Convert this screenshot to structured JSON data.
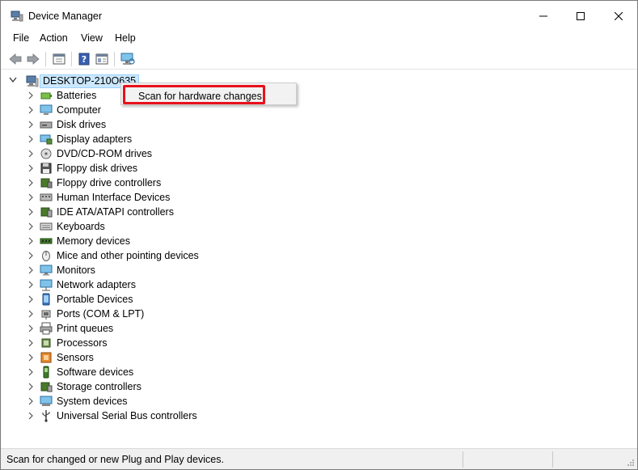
{
  "window": {
    "title": "Device Manager"
  },
  "menubar": {
    "items": [
      "File",
      "Action",
      "View",
      "Help"
    ]
  },
  "toolbar": {
    "buttons": [
      "back-arrow-icon",
      "forward-arrow-icon",
      "properties-pane-icon",
      "help-icon",
      "show-hide-tree-icon",
      "scan-hardware-icon"
    ]
  },
  "tree": {
    "root": "DESKTOP-210O635",
    "nodes": [
      {
        "label": "Batteries",
        "icon": "battery-icon"
      },
      {
        "label": "Computer",
        "icon": "computer-icon"
      },
      {
        "label": "Disk drives",
        "icon": "disk-drive-icon"
      },
      {
        "label": "Display adapters",
        "icon": "display-adapter-icon"
      },
      {
        "label": "DVD/CD-ROM drives",
        "icon": "dvd-drive-icon"
      },
      {
        "label": "Floppy disk drives",
        "icon": "floppy-drive-icon"
      },
      {
        "label": "Floppy drive controllers",
        "icon": "floppy-controller-icon"
      },
      {
        "label": "Human Interface Devices",
        "icon": "hid-icon"
      },
      {
        "label": "IDE ATA/ATAPI controllers",
        "icon": "ide-controller-icon"
      },
      {
        "label": "Keyboards",
        "icon": "keyboard-icon"
      },
      {
        "label": "Memory devices",
        "icon": "memory-icon"
      },
      {
        "label": "Mice and other pointing devices",
        "icon": "mouse-icon"
      },
      {
        "label": "Monitors",
        "icon": "monitor-icon"
      },
      {
        "label": "Network adapters",
        "icon": "network-adapter-icon"
      },
      {
        "label": "Portable Devices",
        "icon": "portable-device-icon"
      },
      {
        "label": "Ports (COM & LPT)",
        "icon": "port-icon"
      },
      {
        "label": "Print queues",
        "icon": "printer-icon"
      },
      {
        "label": "Processors",
        "icon": "processor-icon"
      },
      {
        "label": "Sensors",
        "icon": "sensor-icon"
      },
      {
        "label": "Software devices",
        "icon": "software-device-icon"
      },
      {
        "label": "Storage controllers",
        "icon": "storage-controller-icon"
      },
      {
        "label": "System devices",
        "icon": "system-device-icon"
      },
      {
        "label": "Universal Serial Bus controllers",
        "icon": "usb-icon"
      }
    ]
  },
  "context_menu": {
    "item": "Scan for hardware changes",
    "highlight_color": "#e8111b"
  },
  "statusbar": {
    "text": "Scan for changed or new Plug and Play devices."
  },
  "colors": {
    "selection_bg": "#cce8ff",
    "selection_border": "#99d1ff",
    "menu_bg": "#f2f2f2"
  }
}
